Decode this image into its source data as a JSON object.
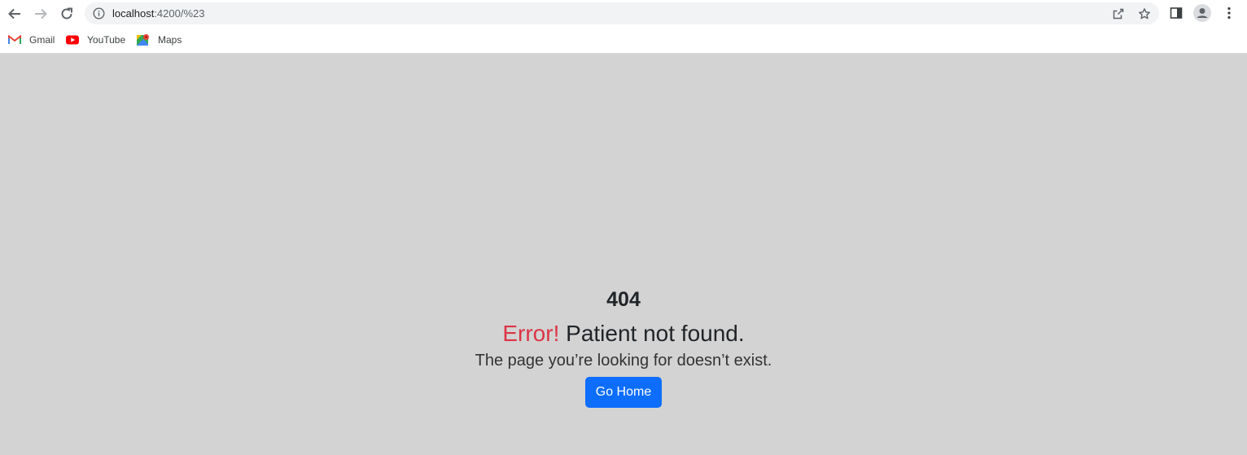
{
  "browser": {
    "url_host": "localhost",
    "url_rest": ":4200/%23",
    "bookmarks": [
      {
        "label": "Gmail",
        "icon": "gmail-icon"
      },
      {
        "label": "YouTube",
        "icon": "youtube-icon"
      },
      {
        "label": "Maps",
        "icon": "maps-icon"
      }
    ]
  },
  "page": {
    "code": "404",
    "error_word": "Error!",
    "error_message": " Patient not found.",
    "subtext": "The page you’re looking for doesn’t exist.",
    "button_label": "Go Home"
  },
  "colors": {
    "background": "#d3d3d3",
    "error": "#dc3545",
    "button": "#0d6efd"
  }
}
